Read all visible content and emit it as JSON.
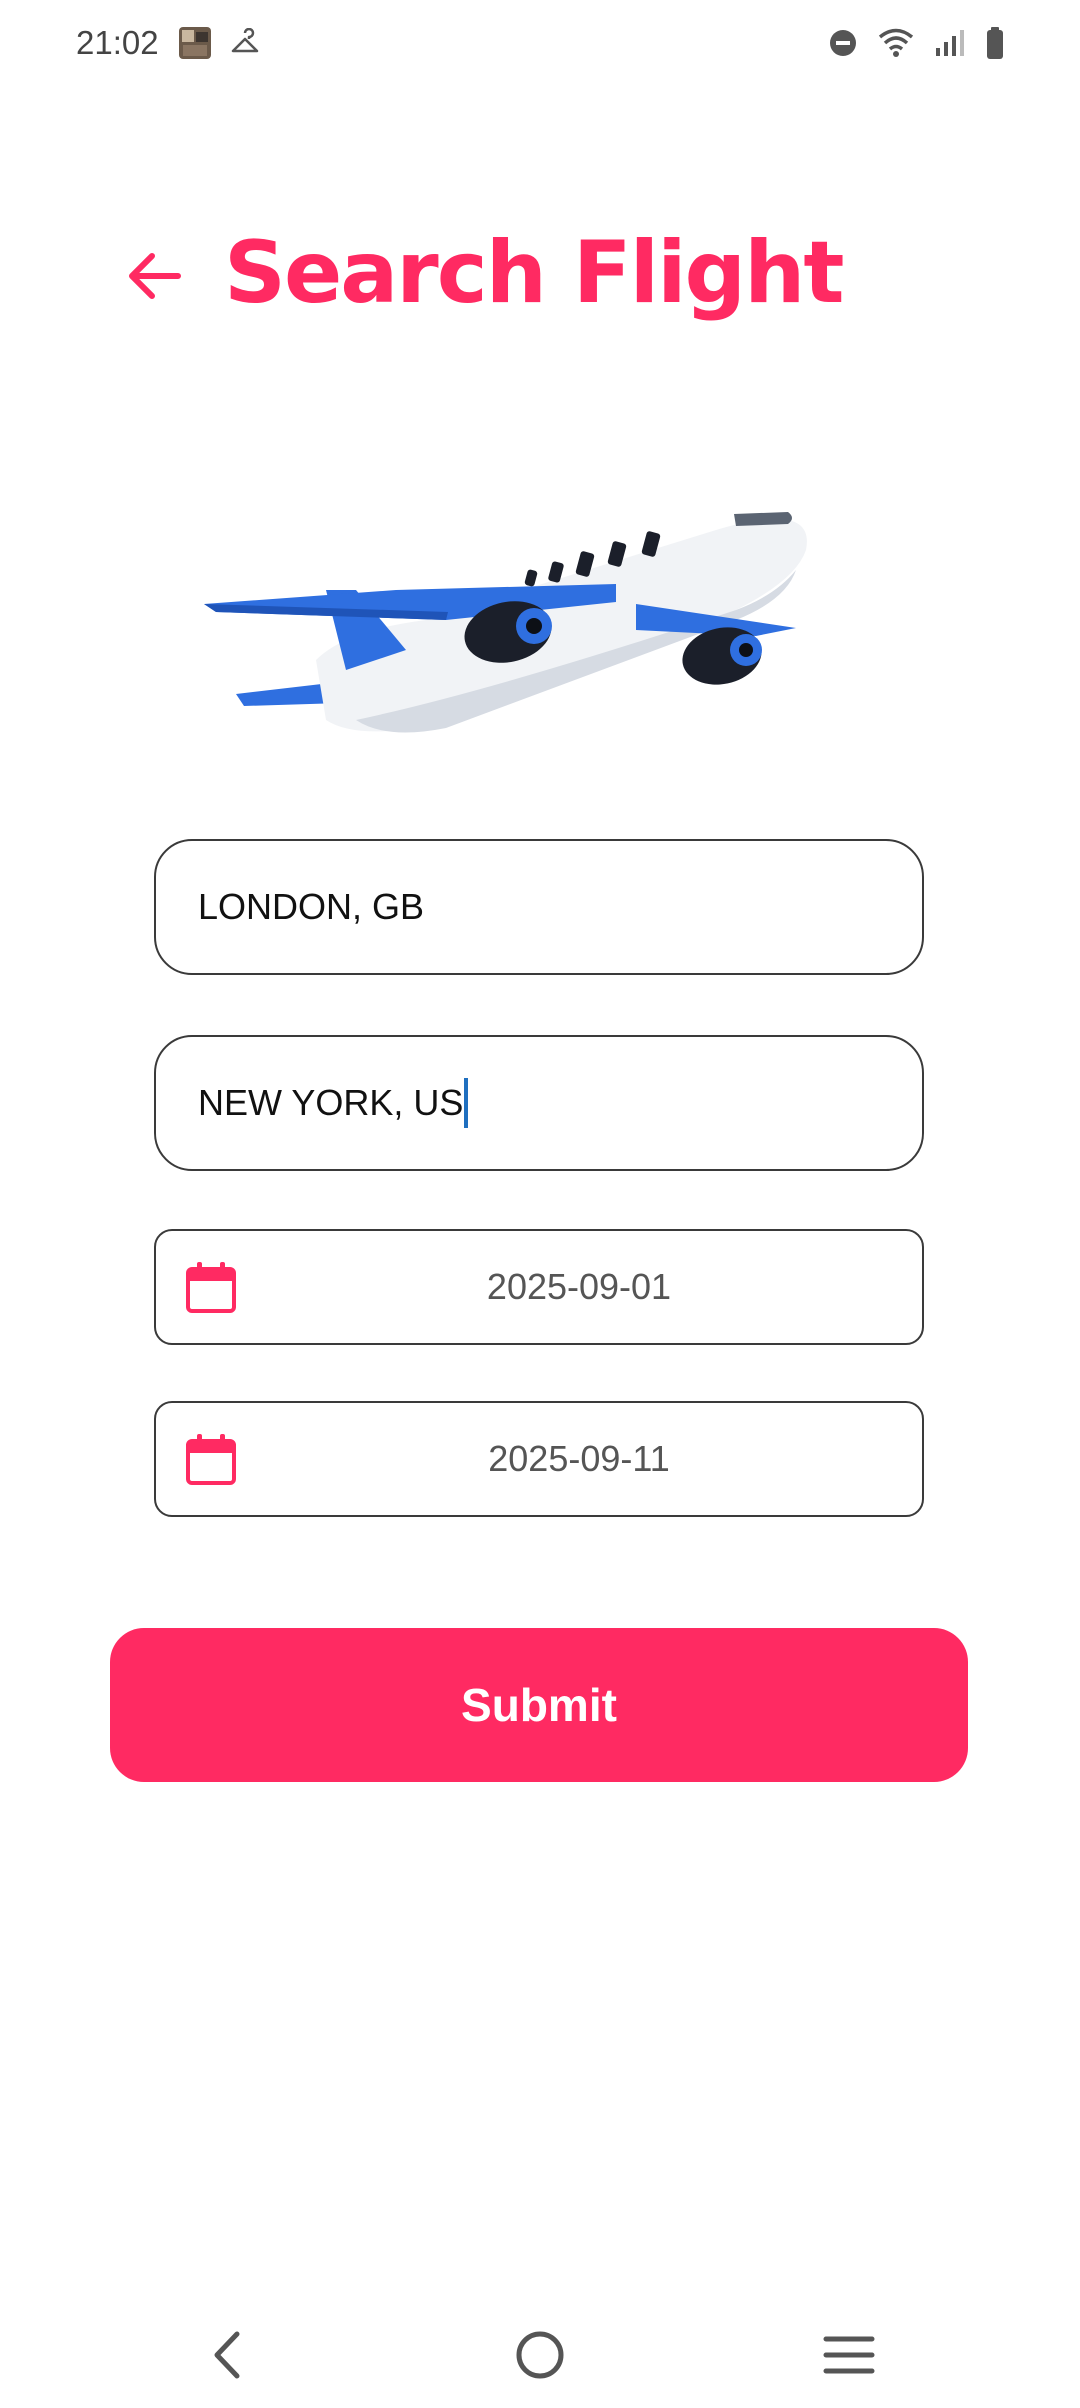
{
  "status_bar": {
    "time": "21:02"
  },
  "header": {
    "title": "Search Flight",
    "back_icon": "arrow-left-icon"
  },
  "illustration": {
    "name": "airplane",
    "colors": {
      "wing": "#2f6fe0",
      "body": "#f1f3f6",
      "engine": "#1b1f2a"
    }
  },
  "form": {
    "origin": {
      "value": "LONDON, GB"
    },
    "destination": {
      "value": "NEW YORK, US"
    },
    "start_date": {
      "value": "2025-09-01",
      "icon": "calendar-icon"
    },
    "end_date": {
      "value": "2025-09-11",
      "icon": "calendar-icon"
    },
    "submit_label": "Submit"
  },
  "nav_bar": {
    "back_icon": "nav-back-icon",
    "home_icon": "nav-home-icon",
    "menu_icon": "nav-menu-icon"
  },
  "theme": {
    "accent": "#ff2a62",
    "border": "#3a3a3a"
  }
}
